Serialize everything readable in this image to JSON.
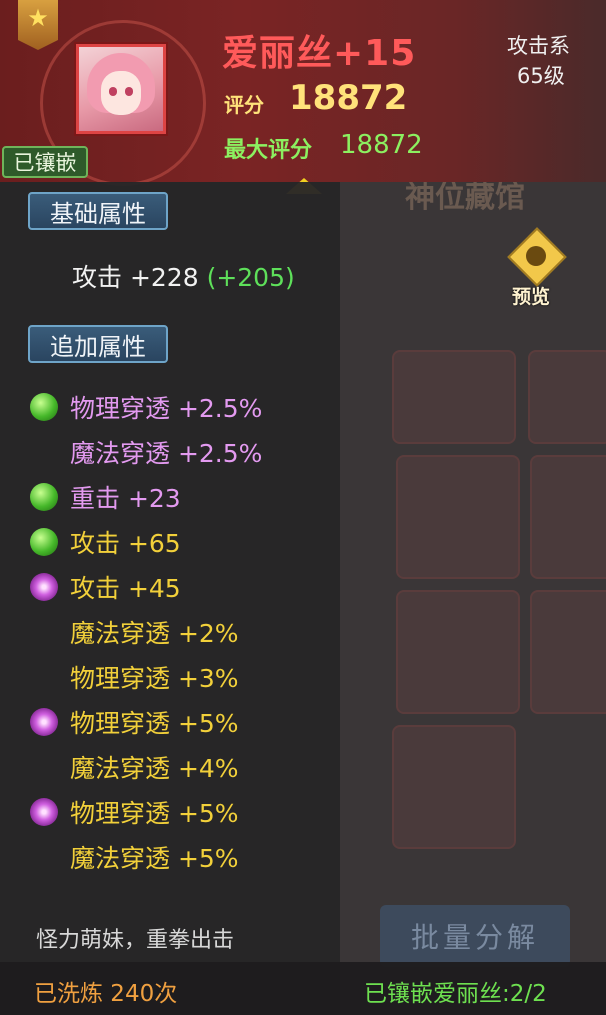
{
  "item": {
    "name": "爱丽丝+15",
    "score_label": "评分",
    "score": "18872",
    "max_score_label": "最大评分",
    "max_score": "18872",
    "class": "攻击系",
    "level": "65级",
    "embedded_tag": "已镶嵌"
  },
  "base_section": {
    "title": "基础属性",
    "attr": "攻击 +228",
    "bonus": "(+205)"
  },
  "extra_section": {
    "title": "追加属性",
    "rows": [
      {
        "orb": "green",
        "text": "物理穿透 +2.5%",
        "color": "purple"
      },
      {
        "orb": "none",
        "text": "魔法穿透 +2.5%",
        "color": "purple"
      },
      {
        "orb": "green",
        "text": "重击 +23",
        "color": "purple"
      },
      {
        "orb": "green",
        "text": "攻击 +65",
        "color": "yellow"
      },
      {
        "orb": "purple",
        "text": "攻击 +45",
        "color": "yellow"
      },
      {
        "orb": "none",
        "text": "魔法穿透 +2%",
        "color": "yellow"
      },
      {
        "orb": "none",
        "text": "物理穿透 +3%",
        "color": "yellow"
      },
      {
        "orb": "purple",
        "text": "物理穿透 +5%",
        "color": "yellow"
      },
      {
        "orb": "none",
        "text": "魔法穿透 +4%",
        "color": "yellow"
      },
      {
        "orb": "purple",
        "text": "物理穿透 +5%",
        "color": "yellow"
      },
      {
        "orb": "none",
        "text": "魔法穿透 +5%",
        "color": "yellow"
      }
    ]
  },
  "flavor_text": "怪力萌妹，重拳出击",
  "footer": {
    "refined": "已洗炼 240次",
    "embedded_count": "已镶嵌爱丽丝:2/2"
  },
  "background": {
    "collection_title": "神位藏馆",
    "preview_label": "预览",
    "batch_button": "批量分解"
  },
  "colors": {
    "name": "#ff5a5a",
    "score": "#ffe27a",
    "max_score": "#8cf060",
    "purple_attr": "#e39af0",
    "yellow_attr": "#f2d03a",
    "bonus_green": "#5ee05a"
  }
}
